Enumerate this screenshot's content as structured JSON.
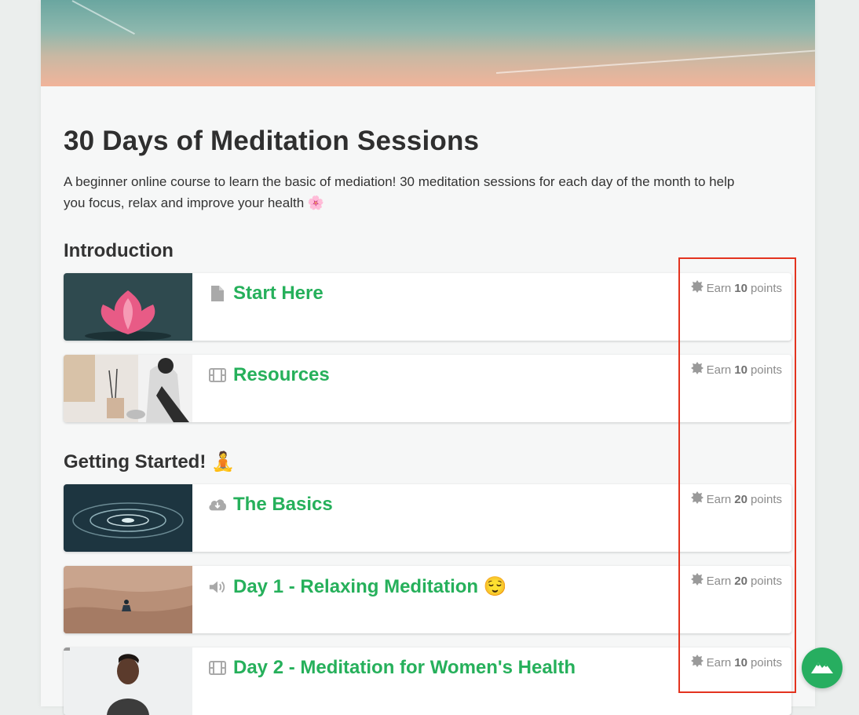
{
  "course": {
    "title": "30 Days of Meditation Sessions",
    "description": "A beginner online course to learn the basic of mediation! 30 meditation sessions for each day of the month to help you focus, relax and improve your health 🌸"
  },
  "sections": [
    {
      "title": "Introduction",
      "items": [
        {
          "title": "Start Here",
          "icon": "file-icon",
          "earn_prefix": "Earn",
          "points": "10",
          "earn_suffix": "points"
        },
        {
          "title": "Resources",
          "icon": "film-icon",
          "earn_prefix": "Earn",
          "points": "10",
          "earn_suffix": "points"
        }
      ]
    },
    {
      "title": "Getting Started! 🧘",
      "items": [
        {
          "title": "The Basics",
          "icon": "cloud-download-icon",
          "earn_prefix": "Earn",
          "points": "20",
          "earn_suffix": "points"
        },
        {
          "title": "Day 1 - Relaxing Meditation 😌",
          "icon": "speaker-icon",
          "earn_prefix": "Earn",
          "points": "20",
          "earn_suffix": "points"
        },
        {
          "title": "Day 2 - Meditation for Women's Health",
          "icon": "film-icon",
          "earn_prefix": "Earn",
          "points": "10",
          "earn_suffix": "points"
        }
      ]
    }
  ],
  "colors": {
    "accent": "#26b05b",
    "highlight": "#e3331f",
    "fab": "#27ae60"
  },
  "fab_icon": "mountain-icon"
}
